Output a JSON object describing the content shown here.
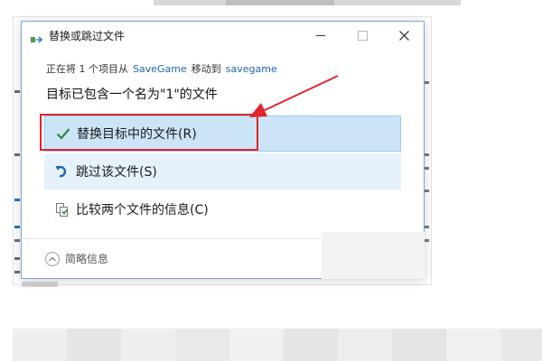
{
  "dialog": {
    "title": "替换或跳过文件",
    "status": {
      "prefix": "正在将 1 个项目从",
      "source": "SaveGame",
      "middle": "移动到",
      "destination": "savegame"
    },
    "heading": "目标已包含一个名为\"1\"的文件",
    "options": [
      {
        "label": "替换目标中的文件(R)",
        "icon": "checkmark-icon"
      },
      {
        "label": "跳过该文件(S)",
        "icon": "skip-arrow-icon"
      },
      {
        "label": "比较两个文件的信息(C)",
        "icon": "compare-files-icon"
      }
    ],
    "details_label": "简略信息"
  },
  "colors": {
    "accent": "#1b64b0",
    "selected_bg": "#cce4f7",
    "hover_bg": "#e5f1fb",
    "annotation_red": "#e0242b",
    "check_green": "#2a8c3c"
  }
}
